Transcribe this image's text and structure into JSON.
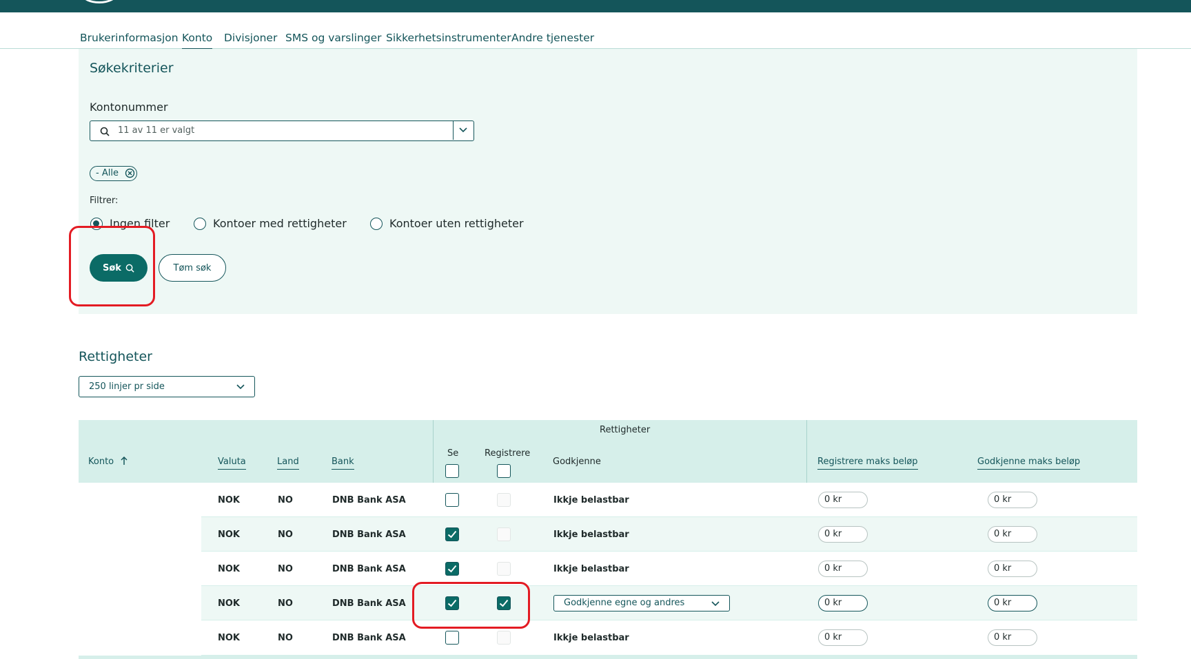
{
  "colors": {
    "brand": "#14555a",
    "accent": "#0b6b66",
    "panel": "#eef8f5",
    "table_header": "#d6efea",
    "annotation": "#e31b23"
  },
  "nav": {
    "tabs": [
      "Brukerinformasjon",
      "Konto",
      "Divisjoner",
      "SMS og varslinger",
      "Sikkerhetsinstrumenter",
      "Andre tjenester"
    ],
    "active_tab": "Konto"
  },
  "search": {
    "title": "Søkekriterier",
    "account_label": "Kontonummer",
    "account_value": "11 av 11 er valgt",
    "chip": "- Alle",
    "filter_label": "Filtrer:",
    "filter_options": [
      "Ingen filter",
      "Kontoer med rettigheter",
      "Kontoer uten rettigheter"
    ],
    "filter_selected": "Ingen filter",
    "search_button": "Søk",
    "clear_button": "Tøm søk"
  },
  "rights": {
    "title": "Rettigheter",
    "page_size": "250 linjer pr side",
    "group_header": "Rettigheter",
    "columns": {
      "konto": "Konto",
      "valuta": "Valuta",
      "land": "Land",
      "bank": "Bank",
      "se": "Se",
      "registrere": "Registrere",
      "godkjenne": "Godkjenne",
      "reg_max": "Registrere maks beløp",
      "godk_max": "Godkjenne maks beløp"
    },
    "rows": [
      {
        "valuta": "NOK",
        "land": "NO",
        "bank": "DNB Bank ASA",
        "se": false,
        "registrere": false,
        "godkjenne": "Ikkje belastbar",
        "reg_max": "0 kr",
        "godk_max": "0 kr"
      },
      {
        "valuta": "NOK",
        "land": "NO",
        "bank": "DNB Bank ASA",
        "se": true,
        "registrere": false,
        "godkjenne": "Ikkje belastbar",
        "reg_max": "0 kr",
        "godk_max": "0 kr"
      },
      {
        "valuta": "NOK",
        "land": "NO",
        "bank": "DNB Bank ASA",
        "se": true,
        "registrere": false,
        "godkjenne": "Ikkje belastbar",
        "reg_max": "0 kr",
        "godk_max": "0 kr"
      },
      {
        "valuta": "NOK",
        "land": "NO",
        "bank": "DNB Bank ASA",
        "se": true,
        "registrere": true,
        "godkjenne": "Godkjenne egne og andres",
        "reg_max": "0 kr",
        "godk_max": "0 kr"
      },
      {
        "valuta": "NOK",
        "land": "NO",
        "bank": "DNB Bank ASA",
        "se": false,
        "registrere": false,
        "godkjenne": "Ikkje belastbar",
        "reg_max": "0 kr",
        "godk_max": "0 kr"
      }
    ]
  }
}
